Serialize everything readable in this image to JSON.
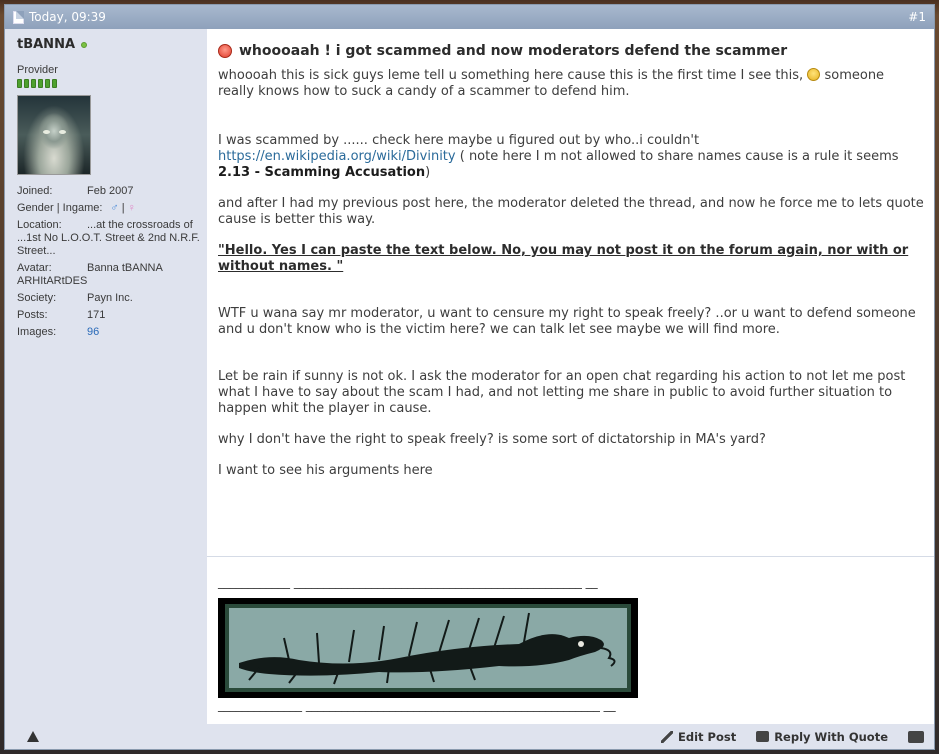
{
  "header": {
    "date": "Today, 09:39",
    "post_number": "#1"
  },
  "user": {
    "name": "tBANNA",
    "title": "Provider",
    "reputation_pips": 6,
    "joined_label": "Joined:",
    "joined": "Feb 2007",
    "gender_label": "Gender | Ingame:",
    "location_label": "Location:",
    "location": "...at the crossroads of ...1st No L.O.O.T. Street & 2nd N.R.F. Street...",
    "avatar_label": "Avatar:",
    "avatar": "Banna tBANNA ARHItARtDES",
    "society_label": "Society:",
    "society": "Payn Inc.",
    "posts_label": "Posts:",
    "posts": "171",
    "images_label": "Images:",
    "images": "96"
  },
  "post": {
    "title": "whoooaah ! i got scammed and now moderators defend the scammer",
    "p1a": "whoooah this is sick guys leme tell u something here cause this is the first time I see this,",
    "p1b": " someone really knows how to suck a candy of a scammer to defend him.",
    "p2a": "I was scammed by ...... check here maybe u figured out by who..i couldn't",
    "p2_link": "https://en.wikipedia.org/wiki/Divinity",
    "p2b": " ( note here I m not allowed to share names cause is a rule it seems ",
    "p2_bold": "2.13 - Scamming Accusation",
    "p2c": ")",
    "p3": "and after I had my previous post here, the moderator deleted the thread, and now he force me to lets quote cause is better this way.",
    "p4": "\"Hello. Yes I can paste the text below. No, you may not post it on the forum again, nor with or without names. \"",
    "p5": "WTF u wana say mr moderator, u want to censure my right to speak freely? ..or u want to defend someone and u don't know who is the victim here? we can talk let see maybe we will find more.",
    "p6": "Let be rain if sunny is not ok. I ask the moderator for an open chat regarding his action to not let me post what I have to say about the scam I had, and not letting me share in public to avoid further situation to happen whit the player in cause.",
    "p7": "why I don't have the right to speak freely? is some sort of dictatorship in MA's yard?",
    "p8": "I want to see his arguments here"
  },
  "signature": {
    "line_top": "____________ ________________________________________________ __",
    "line_bottom": "______________ _________________________________________________ __"
  },
  "footer": {
    "edit": "Edit Post",
    "reply": "Reply With Quote"
  },
  "colors": {
    "header": "#8ea1bb",
    "sidebar": "#dfe3ee",
    "link": "#2a6a9a",
    "online": "#7bc142"
  },
  "icons": [
    "document-icon",
    "online-dot-icon",
    "angry-smiley-icon",
    "smile-icon",
    "report-icon",
    "pencil-icon",
    "reply-quote-icon",
    "multi-quote-icon",
    "male-icon",
    "female-icon"
  ]
}
